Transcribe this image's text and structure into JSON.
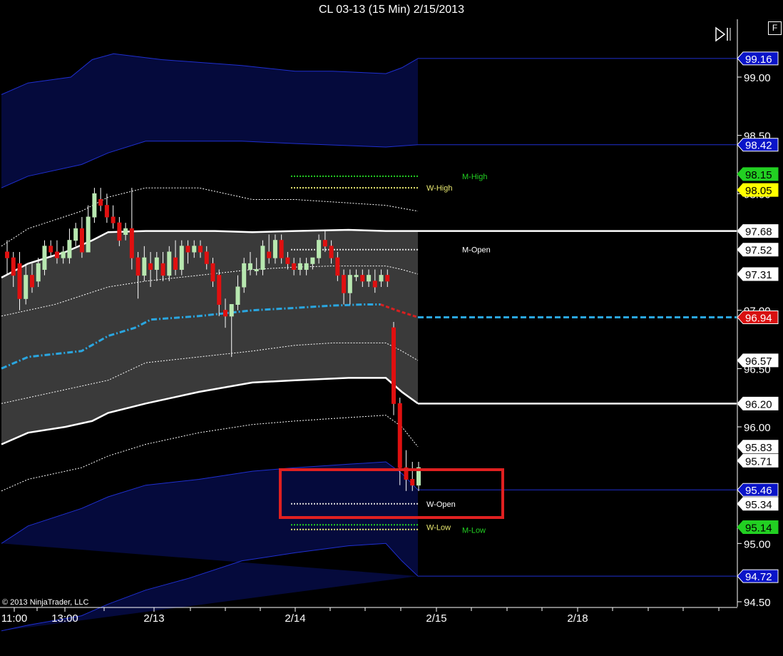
{
  "window": {
    "title": "CL 03-13 (15 Min)  2/15/2013",
    "f_button_label": "F",
    "copyright": "© 2013 NinjaTrader, LLC"
  },
  "colors": {
    "background": "#000000",
    "blue_band": "#050a3c",
    "blue_line": "#1f2fd0",
    "gray_band": "#3a3a3a",
    "white_line": "#ffffff",
    "vwap": "#2aa6e0",
    "vwap_down": "#d82020",
    "up_candle": "#b8e8b0",
    "down_candle": "#e01010",
    "m_level": "#22d022",
    "w_level": "#e8e870",
    "highlight_box": "#e02020"
  },
  "chart_data": {
    "type": "candlestick",
    "title": "CL 03-13 (15 Min)  2/15/2013",
    "ylim": [
      94.45,
      99.35
    ],
    "y_ticks": [
      "94.50",
      "95.00",
      "96.00",
      "96.50",
      "97.00",
      "98.00",
      "98.50",
      "99.00"
    ],
    "x_ticks": [
      "11:00",
      "13:00",
      "2/13",
      "2/14",
      "2/15",
      "2/18"
    ],
    "price_markers": [
      {
        "value": "99.16",
        "style": "blue"
      },
      {
        "value": "98.42",
        "style": "blue"
      },
      {
        "value": "98.15",
        "style": "green"
      },
      {
        "value": "98.05",
        "style": "yellow"
      },
      {
        "value": "97.68",
        "style": "white"
      },
      {
        "value": "97.52",
        "style": "white"
      },
      {
        "value": "97.31",
        "style": "white"
      },
      {
        "value": "96.94",
        "style": "red"
      },
      {
        "value": "96.57",
        "style": "white"
      },
      {
        "value": "96.20",
        "style": "white"
      },
      {
        "value": "95.83",
        "style": "white"
      },
      {
        "value": "95.71",
        "style": "white"
      },
      {
        "value": "95.46",
        "style": "blue"
      },
      {
        "value": "95.34",
        "style": "white"
      },
      {
        "value": "95.14",
        "style": "green"
      },
      {
        "value": "94.72",
        "style": "blue"
      }
    ],
    "level_labels": [
      {
        "text": "M-High",
        "value": 98.15,
        "color": "green"
      },
      {
        "text": "W-High",
        "value": 98.05,
        "color": "yellow"
      },
      {
        "text": "M-Open",
        "value": 97.52,
        "color": "white"
      },
      {
        "text": "W-Open",
        "value": 95.34,
        "color": "white"
      },
      {
        "text": "W-Low",
        "value": 95.14,
        "color": "yellow"
      },
      {
        "text": "M-Low",
        "value": 95.14,
        "color": "green"
      }
    ],
    "candles": [
      [
        97.5,
        97.6,
        97.3,
        97.45
      ],
      [
        97.45,
        97.5,
        97.2,
        97.3
      ],
      [
        97.4,
        97.5,
        97.0,
        97.1
      ],
      [
        97.1,
        97.4,
        97.05,
        97.3
      ],
      [
        97.3,
        97.4,
        97.15,
        97.2
      ],
      [
        97.25,
        97.45,
        97.2,
        97.4
      ],
      [
        97.35,
        97.6,
        97.3,
        97.55
      ],
      [
        97.55,
        97.6,
        97.45,
        97.5
      ],
      [
        97.5,
        97.6,
        97.4,
        97.45
      ],
      [
        97.45,
        97.55,
        97.4,
        97.5
      ],
      [
        97.45,
        97.7,
        97.4,
        97.6
      ],
      [
        97.6,
        97.75,
        97.55,
        97.7
      ],
      [
        97.7,
        97.8,
        97.45,
        97.5
      ],
      [
        97.5,
        97.9,
        97.5,
        97.8
      ],
      [
        97.8,
        98.05,
        97.75,
        98.0
      ],
      [
        97.95,
        98.05,
        97.85,
        97.9
      ],
      [
        97.9,
        98.0,
        97.75,
        97.8
      ],
      [
        97.8,
        97.9,
        97.7,
        97.75
      ],
      [
        97.75,
        97.8,
        97.55,
        97.6
      ],
      [
        97.65,
        97.75,
        97.6,
        97.7
      ],
      [
        97.7,
        98.05,
        97.35,
        97.45
      ],
      [
        97.45,
        97.5,
        97.1,
        97.3
      ],
      [
        97.3,
        97.55,
        97.25,
        97.45
      ],
      [
        97.4,
        97.5,
        97.2,
        97.35
      ],
      [
        97.35,
        97.5,
        97.25,
        97.45
      ],
      [
        97.4,
        97.5,
        97.25,
        97.3
      ],
      [
        97.3,
        97.55,
        97.25,
        97.5
      ],
      [
        97.45,
        97.6,
        97.3,
        97.35
      ],
      [
        97.35,
        97.6,
        97.3,
        97.55
      ],
      [
        97.55,
        97.6,
        97.4,
        97.5
      ],
      [
        97.5,
        97.6,
        97.45,
        97.55
      ],
      [
        97.55,
        97.6,
        97.45,
        97.5
      ],
      [
        97.5,
        97.55,
        97.35,
        97.4
      ],
      [
        97.4,
        97.45,
        97.2,
        97.25
      ],
      [
        97.3,
        97.35,
        96.95,
        97.05
      ],
      [
        97.0,
        97.1,
        96.85,
        96.95
      ],
      [
        96.95,
        97.05,
        96.6,
        97.05
      ],
      [
        97.05,
        97.3,
        97.0,
        97.2
      ],
      [
        97.2,
        97.45,
        97.15,
        97.4
      ],
      [
        97.35,
        97.5,
        97.3,
        97.4
      ],
      [
        97.35,
        97.45,
        97.3,
        97.35
      ],
      [
        97.35,
        97.6,
        97.3,
        97.55
      ],
      [
        97.5,
        97.65,
        97.4,
        97.45
      ],
      [
        97.45,
        97.65,
        97.4,
        97.6
      ],
      [
        97.6,
        97.65,
        97.4,
        97.45
      ],
      [
        97.45,
        97.5,
        97.35,
        97.4
      ],
      [
        97.4,
        97.45,
        97.3,
        97.35
      ],
      [
        97.35,
        97.45,
        97.3,
        97.4
      ],
      [
        97.35,
        97.45,
        97.3,
        97.4
      ],
      [
        97.4,
        97.45,
        97.35,
        97.45
      ],
      [
        97.45,
        97.65,
        97.4,
        97.6
      ],
      [
        97.6,
        97.68,
        97.5,
        97.55
      ],
      [
        97.55,
        97.6,
        97.4,
        97.45
      ],
      [
        97.45,
        97.5,
        97.25,
        97.3
      ],
      [
        97.3,
        97.35,
        97.05,
        97.15
      ],
      [
        97.15,
        97.35,
        97.05,
        97.3
      ],
      [
        97.3,
        97.35,
        97.25,
        97.3
      ],
      [
        97.3,
        97.35,
        97.2,
        97.25
      ],
      [
        97.25,
        97.35,
        97.2,
        97.3
      ],
      [
        97.25,
        97.35,
        97.15,
        97.2
      ],
      [
        97.25,
        97.35,
        97.2,
        97.3
      ],
      [
        97.3,
        97.35,
        97.2,
        97.25
      ],
      [
        96.85,
        96.9,
        96.1,
        96.2
      ],
      [
        96.2,
        96.25,
        95.5,
        95.65
      ],
      [
        95.65,
        95.8,
        95.45,
        95.55
      ],
      [
        95.55,
        95.7,
        95.45,
        95.5
      ],
      [
        95.5,
        95.7,
        95.45,
        95.65
      ]
    ],
    "bands": {
      "blue_upper_top": [
        [
          0,
          98.85
        ],
        [
          0.05,
          98.95
        ],
        [
          0.13,
          99.0
        ],
        [
          0.17,
          99.15
        ],
        [
          0.21,
          99.2
        ],
        [
          0.3,
          99.15
        ],
        [
          0.45,
          99.1
        ],
        [
          0.55,
          99.05
        ],
        [
          0.62,
          99.05
        ],
        [
          0.72,
          99.03
        ],
        [
          0.75,
          99.08
        ],
        [
          0.78,
          99.16
        ]
      ],
      "blue_upper_bot": [
        [
          0,
          98.05
        ],
        [
          0.05,
          98.15
        ],
        [
          0.15,
          98.25
        ],
        [
          0.2,
          98.35
        ],
        [
          0.27,
          98.45
        ],
        [
          0.45,
          98.45
        ],
        [
          0.55,
          98.43
        ],
        [
          0.72,
          98.4
        ],
        [
          0.78,
          98.42
        ]
      ],
      "white_upper": [
        [
          0,
          97.55
        ],
        [
          0.05,
          97.7
        ],
        [
          0.15,
          97.85
        ],
        [
          0.2,
          97.97
        ],
        [
          0.27,
          98.05
        ],
        [
          0.37,
          98.05
        ],
        [
          0.47,
          97.95
        ],
        [
          0.55,
          97.95
        ],
        [
          0.72,
          97.9
        ],
        [
          0.78,
          97.85
        ]
      ],
      "gray_top": [
        [
          0,
          97.28
        ],
        [
          0.05,
          97.4
        ],
        [
          0.12,
          97.5
        ],
        [
          0.17,
          97.6
        ],
        [
          0.2,
          97.67
        ],
        [
          0.27,
          97.68
        ],
        [
          0.4,
          97.68
        ],
        [
          0.47,
          97.67
        ],
        [
          0.55,
          97.68
        ],
        [
          0.65,
          97.69
        ],
        [
          0.72,
          97.68
        ],
        [
          0.78,
          97.68
        ]
      ],
      "white_inner_upper": [
        [
          0,
          96.95
        ],
        [
          0.1,
          97.05
        ],
        [
          0.2,
          97.2
        ],
        [
          0.27,
          97.25
        ],
        [
          0.37,
          97.3
        ],
        [
          0.47,
          97.35
        ],
        [
          0.55,
          97.37
        ],
        [
          0.62,
          97.38
        ],
        [
          0.72,
          97.38
        ],
        [
          0.75,
          97.35
        ],
        [
          0.78,
          97.31
        ]
      ],
      "vwap": [
        [
          0,
          96.5
        ],
        [
          0.05,
          96.6
        ],
        [
          0.15,
          96.65
        ],
        [
          0.2,
          96.78
        ],
        [
          0.25,
          96.85
        ],
        [
          0.28,
          96.92
        ],
        [
          0.37,
          96.95
        ],
        [
          0.47,
          97.0
        ],
        [
          0.55,
          97.02
        ],
        [
          0.62,
          97.04
        ],
        [
          0.68,
          97.05
        ],
        [
          0.71,
          97.05
        ]
      ],
      "vwap_down": [
        [
          0.71,
          97.05
        ],
        [
          0.74,
          97.0
        ],
        [
          0.78,
          96.94
        ]
      ],
      "white_inner_lower": [
        [
          0,
          96.2
        ],
        [
          0.1,
          96.3
        ],
        [
          0.2,
          96.4
        ],
        [
          0.27,
          96.55
        ],
        [
          0.37,
          96.6
        ],
        [
          0.47,
          96.65
        ],
        [
          0.55,
          96.7
        ],
        [
          0.62,
          96.72
        ],
        [
          0.72,
          96.72
        ],
        [
          0.75,
          96.65
        ],
        [
          0.78,
          96.57
        ]
      ],
      "gray_bot": [
        [
          0,
          95.85
        ],
        [
          0.05,
          95.95
        ],
        [
          0.12,
          96.0
        ],
        [
          0.17,
          96.05
        ],
        [
          0.2,
          96.12
        ],
        [
          0.27,
          96.2
        ],
        [
          0.37,
          96.3
        ],
        [
          0.47,
          96.38
        ],
        [
          0.55,
          96.4
        ],
        [
          0.65,
          96.42
        ],
        [
          0.72,
          96.42
        ],
        [
          0.75,
          96.3
        ],
        [
          0.78,
          96.2
        ]
      ],
      "white_lower": [
        [
          0,
          95.45
        ],
        [
          0.05,
          95.55
        ],
        [
          0.15,
          95.65
        ],
        [
          0.2,
          95.75
        ],
        [
          0.27,
          95.85
        ],
        [
          0.37,
          95.95
        ],
        [
          0.47,
          96.02
        ],
        [
          0.55,
          96.05
        ],
        [
          0.65,
          96.08
        ],
        [
          0.72,
          96.1
        ],
        [
          0.75,
          96.0
        ],
        [
          0.78,
          95.83
        ]
      ],
      "blue_lower_top": [
        [
          0,
          95.0
        ],
        [
          0.05,
          95.15
        ],
        [
          0.15,
          95.3
        ],
        [
          0.2,
          95.4
        ],
        [
          0.27,
          95.5
        ],
        [
          0.37,
          95.55
        ],
        [
          0.47,
          95.62
        ],
        [
          0.55,
          95.65
        ],
        [
          0.65,
          95.68
        ],
        [
          0.72,
          95.7
        ],
        [
          0.75,
          95.6
        ],
        [
          0.78,
          95.46
        ]
      ],
      "blue_lower_bot": [
        [
          0,
          94.25
        ],
        [
          0.05,
          94.3
        ],
        [
          0.15,
          94.38
        ],
        [
          0.2,
          94.48
        ],
        [
          0.27,
          94.6
        ],
        [
          0.35,
          94.7
        ],
        [
          0.45,
          94.85
        ],
        [
          0.55,
          94.92
        ],
        [
          0.65,
          94.98
        ],
        [
          0.72,
          95.0
        ],
        [
          0.75,
          94.85
        ],
        [
          0.78,
          94.72
        ]
      ]
    },
    "grid": false,
    "legend": "none"
  }
}
